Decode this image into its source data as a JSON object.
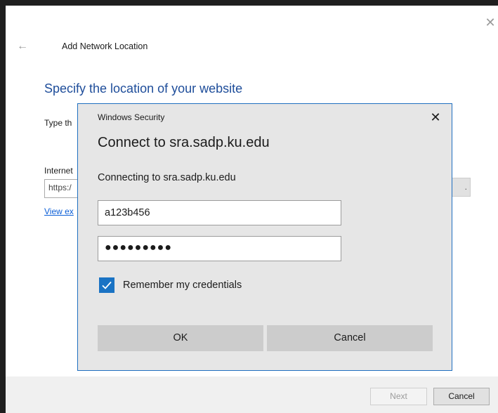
{
  "wizard": {
    "title": "Add Network Location",
    "heading": "Specify the location of your website",
    "instruction_visible": "Type th",
    "address_label_visible": "Internet",
    "address_value_visible": "https:/",
    "browse_visible": ".",
    "examples_link_visible": "View ex",
    "next_label": "Next",
    "cancel_label": "Cancel",
    "close_glyph": "✕",
    "back_glyph": "←"
  },
  "security_dialog": {
    "caption": "Windows Security",
    "close_glyph": "✕",
    "title": "Connect to sra.sadp.ku.edu",
    "subtitle": "Connecting to sra.sadp.ku.edu",
    "username_value": "a123b456",
    "password_mask": "●●●●●●●●●",
    "remember_label": "Remember my credentials",
    "remember_checked": true,
    "ok_label": "OK",
    "cancel_label": "Cancel",
    "accent_color": "#1a73c4"
  }
}
